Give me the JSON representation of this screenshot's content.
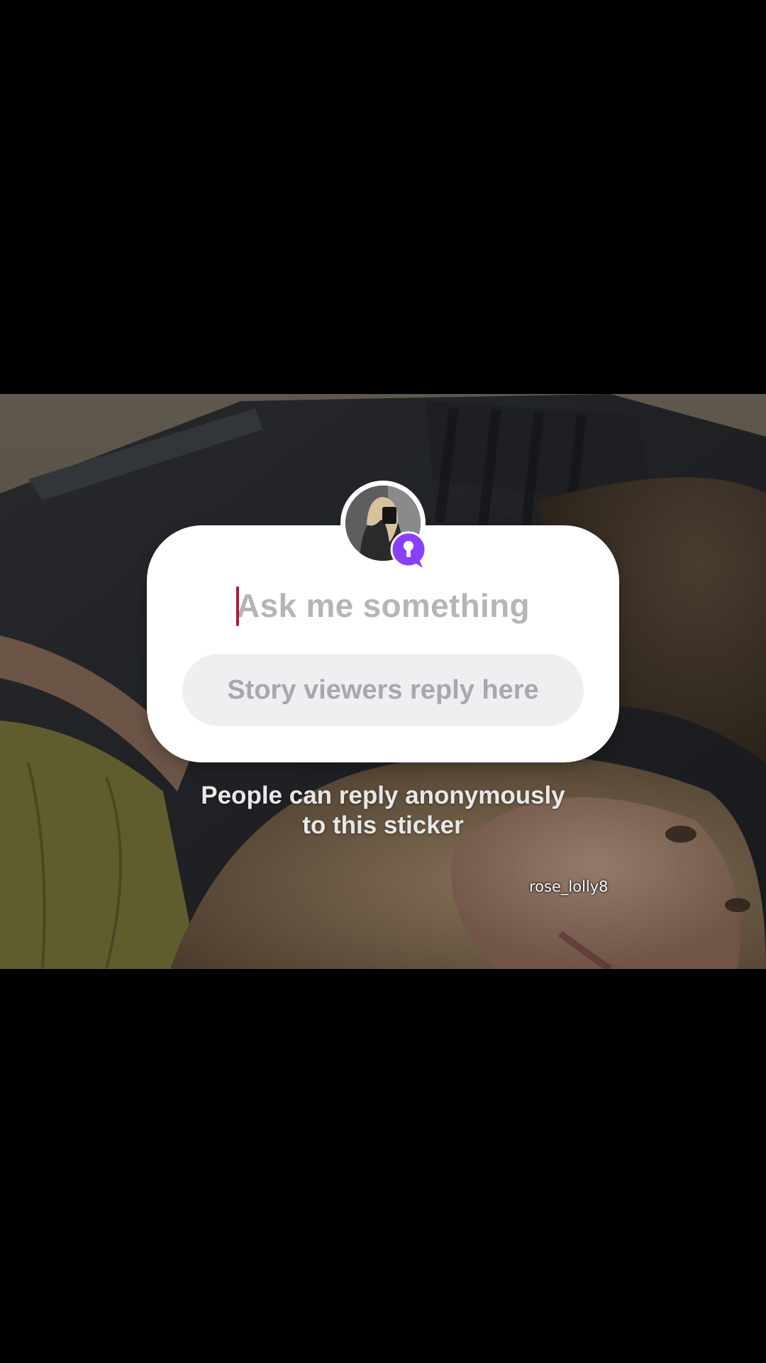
{
  "sticker": {
    "question_placeholder": "Ask me something",
    "reply_placeholder": "Story viewers reply here",
    "badge_icon": "lock-icon",
    "badge_color": "#8a3ffc",
    "caret_color": "#b8123e"
  },
  "hint": {
    "line1": "People can reply anonymously",
    "line2": "to this sticker"
  },
  "watermark": {
    "username": "rose_lolly8"
  }
}
